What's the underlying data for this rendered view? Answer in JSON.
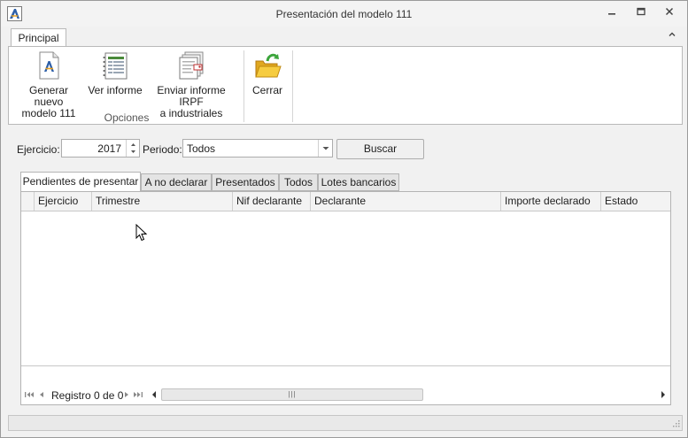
{
  "window": {
    "title": "Presentación del modelo 111",
    "controls": {
      "minimize": "minimize-icon",
      "maximize": "maximize-icon",
      "close": "close-icon"
    }
  },
  "ribbon": {
    "tab_label": "Principal",
    "group_label": "Opciones",
    "buttons": [
      {
        "label_line1": "Generar nuevo",
        "label_line2": "modelo 111",
        "icon": "document-new-icon"
      },
      {
        "label_line1": "Ver informe",
        "label_line2": "",
        "icon": "report-icon"
      },
      {
        "label_line1": "Enviar informe IRPF",
        "label_line2": "a industriales",
        "icon": "send-report-icon"
      },
      {
        "label_line1": "Cerrar",
        "label_line2": "",
        "icon": "folder-close-icon"
      }
    ]
  },
  "filters": {
    "ejercicio_label": "Ejercicio:",
    "ejercicio_value": "2017",
    "periodo_label": "Periodo:",
    "periodo_value": "Todos",
    "buscar_label": "Buscar"
  },
  "tabs": [
    {
      "label": "Pendientes de presentar",
      "active": true
    },
    {
      "label": "A no declarar",
      "active": false
    },
    {
      "label": "Presentados",
      "active": false
    },
    {
      "label": "Todos",
      "active": false
    },
    {
      "label": "Lotes bancarios",
      "active": false
    }
  ],
  "grid": {
    "columns": [
      "Ejercicio",
      "Trimestre",
      "Nif declarante",
      "Declarante",
      "Importe declarado",
      "Estado"
    ],
    "rows": [],
    "record_text": "Registro 0 de 0"
  },
  "colors": {
    "window_bg": "#f1f1f1",
    "ribbon_bg": "#ffffff",
    "border": "#b4b4b4",
    "accent_folder": "#f2c230",
    "accent_arrow": "#3ca53c"
  }
}
